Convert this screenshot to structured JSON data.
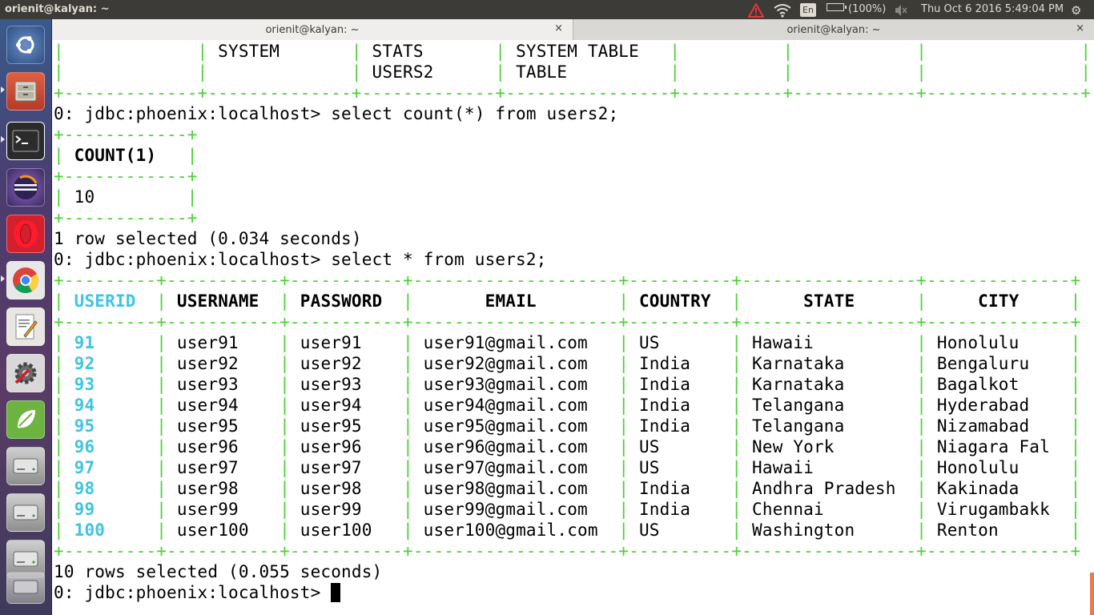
{
  "topbar": {
    "title": "orienit@kalyan: ~",
    "lang": "En",
    "battery": "(100%)",
    "clock": "Thu Oct  6 2016  5:49:04 PM",
    "icons": [
      "warning-icon",
      "wifi-icon",
      "battery-icon",
      "volume-muted-icon",
      "power-icon"
    ]
  },
  "tabs": [
    {
      "label": "orienit@kalyan: ~",
      "close": "×"
    },
    {
      "label": "orienit@kalyan: ~",
      "close": "×"
    }
  ],
  "launcher": [
    "ubuntu-dash-icon",
    "files-icon",
    "terminal-icon",
    "eclipse-icon",
    "opera-icon",
    "chrome-icon",
    "text-editor-icon",
    "system-settings-icon",
    "spring-icon",
    "drive-icon",
    "drive-icon",
    "drive-icon"
  ],
  "colors": {
    "border": "#4cd136",
    "key_column": "#3fc4e2",
    "accent": "#f07746"
  },
  "terminal": {
    "prev_table": [
      [
        "",
        "SYSTEM",
        "STATS",
        "SYSTEM TABLE",
        "",
        "",
        ""
      ],
      [
        "",
        "",
        "USERS2",
        "TABLE",
        "",
        "",
        ""
      ]
    ],
    "prompt": "0: jdbc:phoenix:localhost>",
    "cmd1": "select count(*) from users2;",
    "count_header": "COUNT(1)",
    "count_value": "10",
    "msg1": "1 row selected (0.034 seconds)",
    "cmd2": "select * from users2;",
    "columns": [
      "USERID",
      "USERNAME",
      "PASSWORD",
      "EMAIL",
      "COUNTRY",
      "STATE",
      "CITY"
    ],
    "rows": [
      [
        "91",
        "user91",
        "user91",
        "user91@gmail.com",
        "US",
        "Hawaii",
        "Honolulu"
      ],
      [
        "92",
        "user92",
        "user92",
        "user92@gmail.com",
        "India",
        "Karnataka",
        "Bengaluru"
      ],
      [
        "93",
        "user93",
        "user93",
        "user93@gmail.com",
        "India",
        "Karnataka",
        "Bagalkot"
      ],
      [
        "94",
        "user94",
        "user94",
        "user94@gmail.com",
        "India",
        "Telangana",
        "Hyderabad"
      ],
      [
        "95",
        "user95",
        "user95",
        "user95@gmail.com",
        "India",
        "Telangana",
        "Nizamabad"
      ],
      [
        "96",
        "user96",
        "user96",
        "user96@gmail.com",
        "US",
        "New York",
        "Niagara Fal"
      ],
      [
        "97",
        "user97",
        "user97",
        "user97@gmail.com",
        "US",
        "Hawaii",
        "Honolulu"
      ],
      [
        "98",
        "user98",
        "user98",
        "user98@gmail.com",
        "India",
        "Andhra Pradesh",
        "Kakinada"
      ],
      [
        "99",
        "user99",
        "user99",
        "user99@gmail.com",
        "India",
        "Chennai",
        "Virugambakk"
      ],
      [
        "100",
        "user100",
        "user100",
        "user100@gmail.com",
        "US",
        "Washington",
        "Renton"
      ]
    ],
    "msg2": "10 rows selected (0.055 seconds)"
  }
}
